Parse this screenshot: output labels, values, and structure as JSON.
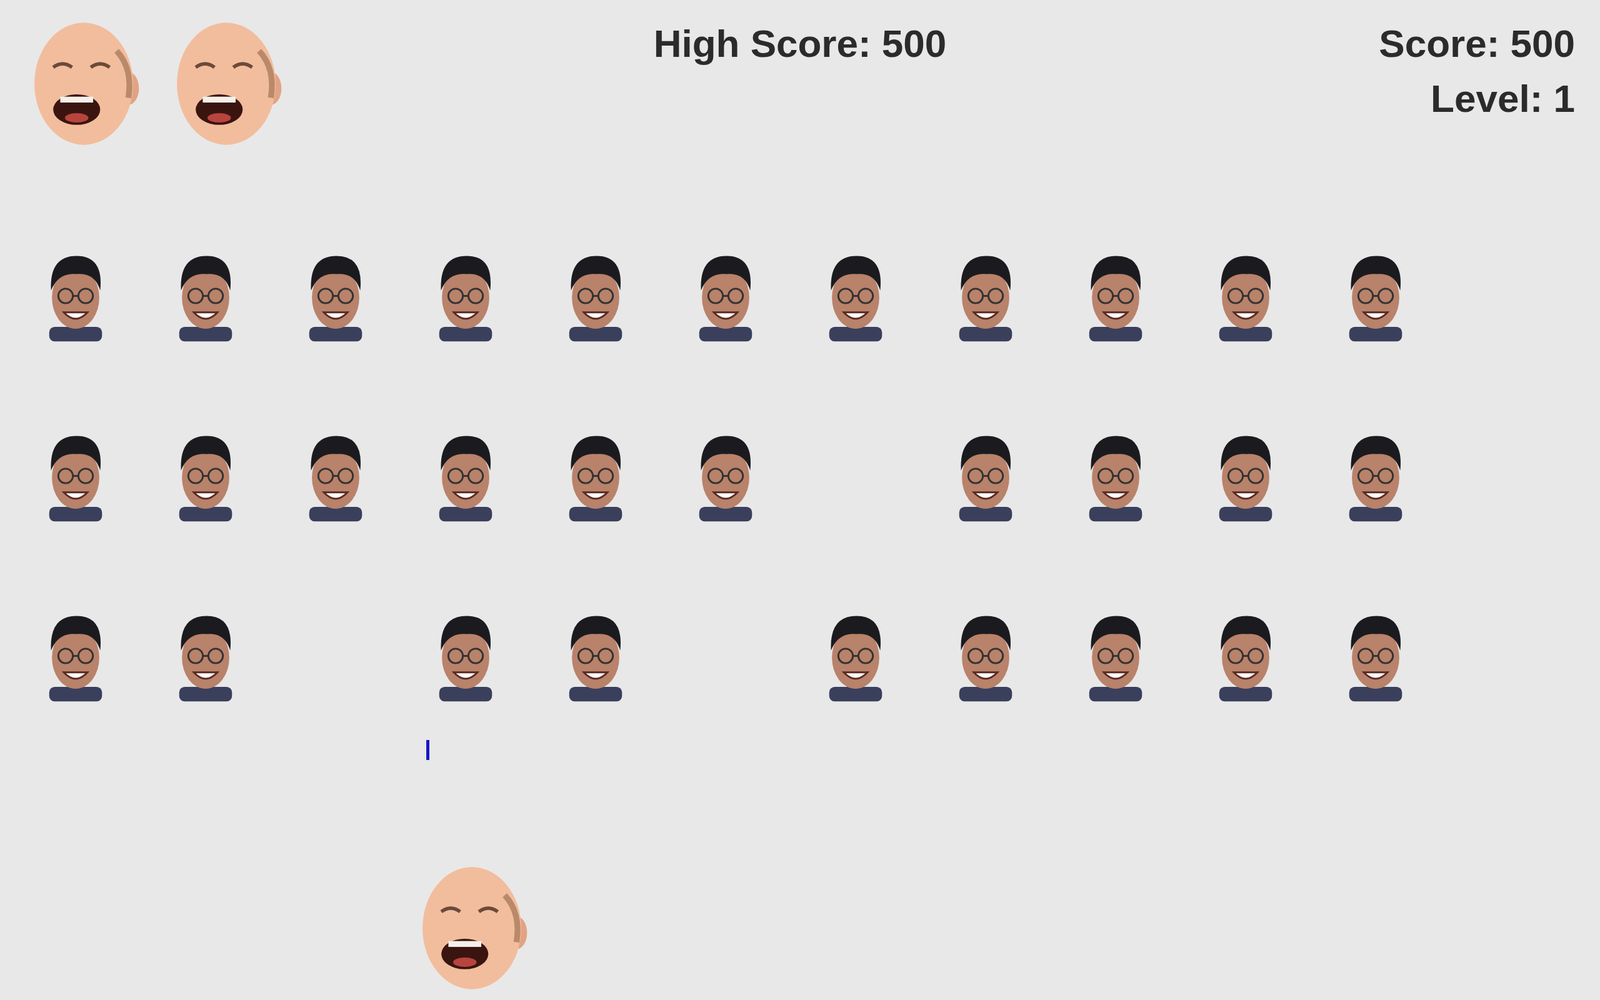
{
  "high_score": "High Score: 500",
  "score": "Score: 500",
  "level": "Level: 1",
  "lives": [
    {
      "remaining": true
    },
    {
      "remaining": true
    }
  ],
  "invaders": [
    [
      {
        "alive": true
      },
      {
        "alive": true
      },
      {
        "alive": true
      },
      {
        "alive": true
      },
      {
        "alive": true
      },
      {
        "alive": true
      },
      {
        "alive": true
      },
      {
        "alive": true
      },
      {
        "alive": true
      },
      {
        "alive": true
      },
      {
        "alive": true
      }
    ],
    [
      {
        "alive": true
      },
      {
        "alive": true
      },
      {
        "alive": true
      },
      {
        "alive": true
      },
      {
        "alive": true
      },
      {
        "alive": true
      },
      {
        "alive": false
      },
      {
        "alive": true
      },
      {
        "alive": true
      },
      {
        "alive": true
      },
      {
        "alive": true
      }
    ],
    [
      {
        "alive": true
      },
      {
        "alive": true
      },
      {
        "alive": false
      },
      {
        "alive": true
      },
      {
        "alive": true
      },
      {
        "alive": false
      },
      {
        "alive": true
      },
      {
        "alive": true
      },
      {
        "alive": true
      },
      {
        "alive": true
      },
      {
        "alive": true
      }
    ]
  ],
  "bullet": {
    "visible": true
  },
  "player": {
    "alive": true
  }
}
